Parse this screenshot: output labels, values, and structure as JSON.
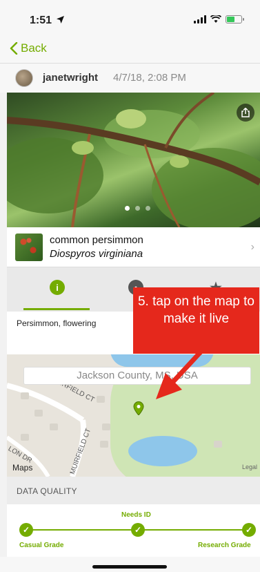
{
  "status_bar": {
    "time": "1:51",
    "battery_level": 0.6
  },
  "nav": {
    "back_label": "Back"
  },
  "observation": {
    "username": "janetwright",
    "date": "4/7/18, 2:08 PM",
    "photo_count": 3,
    "active_photo": 1
  },
  "taxon": {
    "common_name": "common persimmon",
    "scientific_name": "Diospyros virginiana"
  },
  "description": "Persimmon, flowering",
  "map": {
    "location": "Jackson County, MS, USA",
    "logo": "Maps",
    "legal": "Legal",
    "roads": [
      "MUIRFIELD CT",
      "LON DR",
      "MUIRFIELD CT"
    ]
  },
  "callout": {
    "text": "5. tap on the map to make it live",
    "color": "#e5281c"
  },
  "data_quality": {
    "title": "DATA QUALITY",
    "casual": "Casual Grade",
    "needs_id": "Needs ID",
    "research": "Research Grade"
  },
  "colors": {
    "accent": "#74ac00"
  }
}
